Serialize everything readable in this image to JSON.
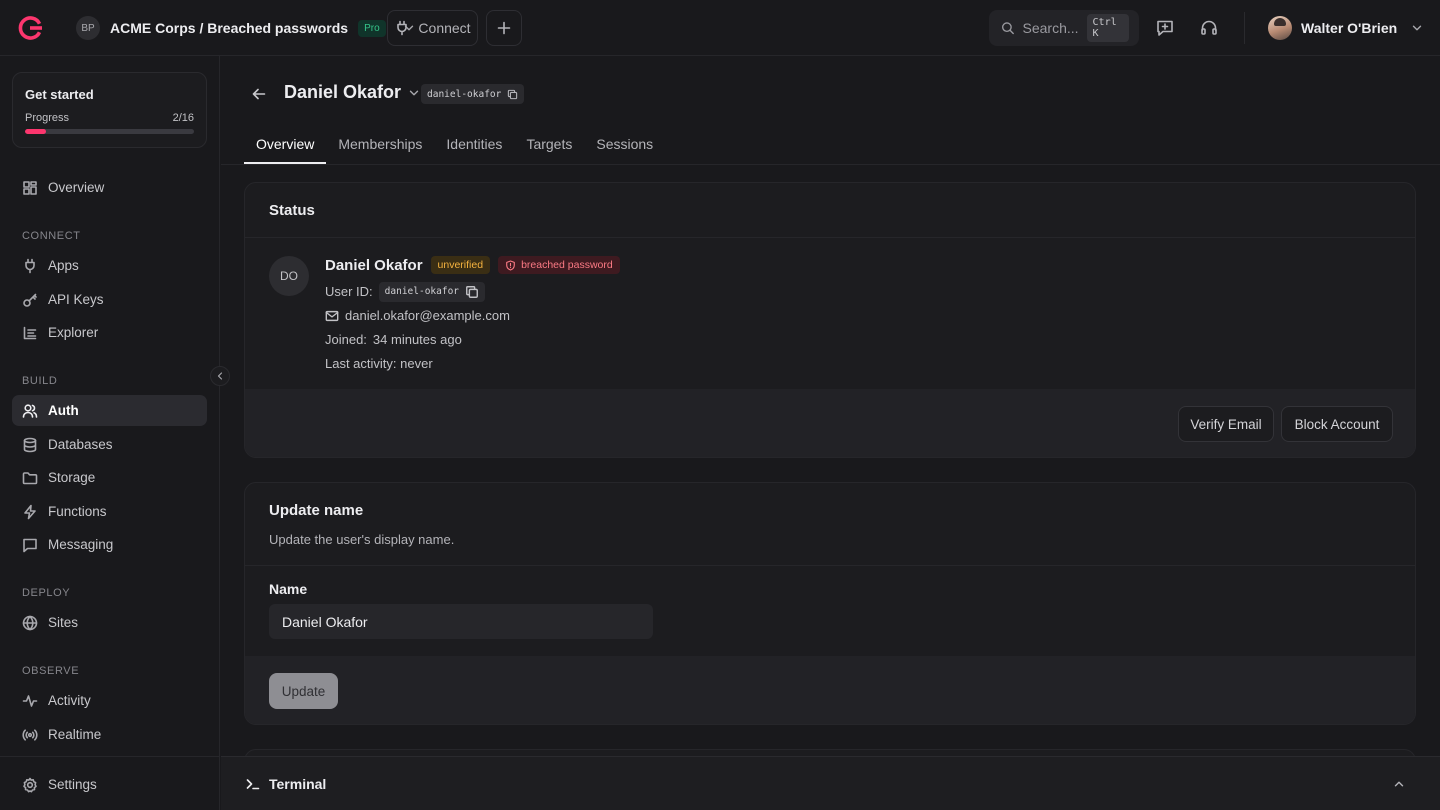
{
  "topbar": {
    "project_avatar": "BP",
    "project_title": "ACME Corps / Breached passwords",
    "plan_badge": "Pro",
    "connect_label": "Connect",
    "search_placeholder": "Search...",
    "search_shortcut": "Ctrl K",
    "user_name": "Walter O'Brien"
  },
  "sidebar": {
    "get_started": {
      "title": "Get started",
      "progress_label": "Progress",
      "progress_text": "2/16",
      "progress_fraction": 0.125
    },
    "overview": "Overview",
    "sections": {
      "connect": "CONNECT",
      "build": "BUILD",
      "deploy": "DEPLOY",
      "observe": "OBSERVE"
    },
    "items": {
      "apps": "Apps",
      "api_keys": "API Keys",
      "explorer": "Explorer",
      "auth": "Auth",
      "databases": "Databases",
      "storage": "Storage",
      "functions": "Functions",
      "messaging": "Messaging",
      "sites": "Sites",
      "activity": "Activity",
      "realtime": "Realtime"
    },
    "settings": "Settings"
  },
  "header": {
    "user_name": "Daniel Okafor",
    "user_id": "daniel-okafor"
  },
  "tabs": [
    "Overview",
    "Memberships",
    "Identities",
    "Targets",
    "Sessions"
  ],
  "status_card": {
    "title": "Status",
    "avatar_initials": "DO",
    "name": "Daniel Okafor",
    "badge_unverified": "unverified",
    "badge_breached": "breached password",
    "user_id_label": "User ID:",
    "user_id": "daniel-okafor",
    "email": "daniel.okafor@example.com",
    "joined_label": "Joined:",
    "joined_value": "34 minutes ago",
    "last_activity": "Last activity: never",
    "verify_button": "Verify Email",
    "block_button": "Block Account"
  },
  "update_card": {
    "title": "Update name",
    "description": "Update the user's display name.",
    "field_label": "Name",
    "field_value": "Daniel Okafor",
    "button": "Update"
  },
  "terminal": {
    "label": "Terminal"
  },
  "colors": {
    "accent": "#fd366e",
    "background": "#19191c",
    "card": "#1c1c1f",
    "warning": "#f5b33f",
    "danger": "#fb7a84",
    "success": "#35c48a"
  }
}
